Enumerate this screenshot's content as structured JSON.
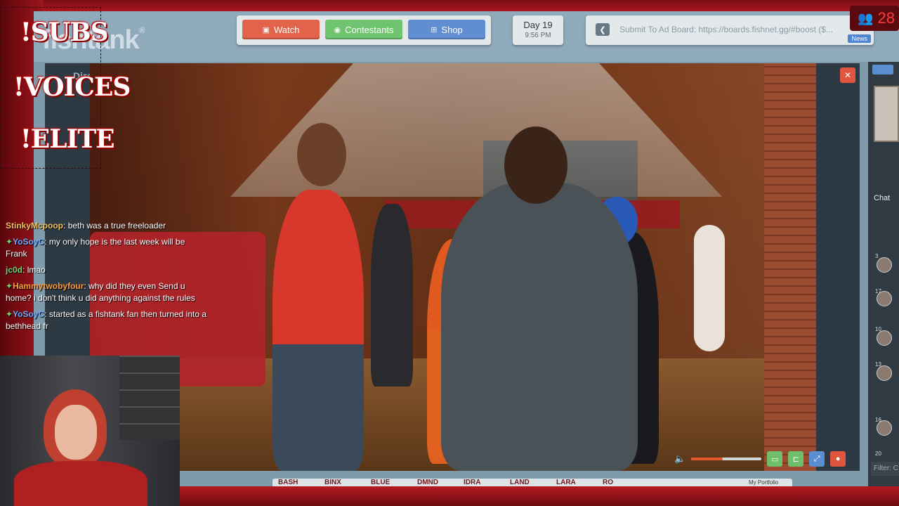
{
  "header": {
    "logo_text": "fishtank",
    "logo_mark": "®",
    "nav": [
      {
        "label": "Watch",
        "icon": "tv-icon",
        "color": "#e1634a"
      },
      {
        "label": "Contestants",
        "icon": "person-icon",
        "color": "#6fc46f"
      },
      {
        "label": "Shop",
        "icon": "cart-icon",
        "color": "#5f8fd2"
      }
    ],
    "day": {
      "label": "Day 19",
      "time": "9:56 PM"
    },
    "ad_board": {
      "text": "Submit To Ad Board: https://boards.fishnet.gg/#boost ($...",
      "news_label": "News"
    },
    "viewer_count": "28"
  },
  "player": {
    "mode_label": "Director Mode",
    "volume_level": 0.45,
    "cam_tabs": [
      "BASH",
      "BINX",
      "BLUE",
      "DMND",
      "IDRA",
      "LAND",
      "LARA",
      "RO"
    ],
    "portfolio_label": "My Portfolio"
  },
  "side": {
    "chat_label": "Chat",
    "ranks": [
      "3",
      "17",
      "10",
      "13",
      "16",
      "20"
    ],
    "filter_placeholder": "Filter: C"
  },
  "overlay": {
    "badges": [
      "!SUBS",
      "!VOICES",
      "!ELITE"
    ],
    "chat": [
      {
        "user": "StinkyMcpoop",
        "text": "beth was a true freeloader",
        "user_color": "#f0c060",
        "gem": false
      },
      {
        "user": "YoSoyC",
        "text": "my only hope is the last week will be Frank",
        "user_color": "#6aa8ff",
        "gem": true
      },
      {
        "user": "jc0d",
        "text": "lmao",
        "user_color": "#6fd66f",
        "gem": false
      },
      {
        "user": "Hammytwobyfour",
        "text": "why did they even Send u home? i don't think u did anything against the rules",
        "user_color": "#ff9a3a",
        "gem": true
      },
      {
        "user": "YoSoyC",
        "text": "started as a fishtank fan then turned into a bethhead fr",
        "user_color": "#6aa8ff",
        "gem": true
      }
    ]
  }
}
